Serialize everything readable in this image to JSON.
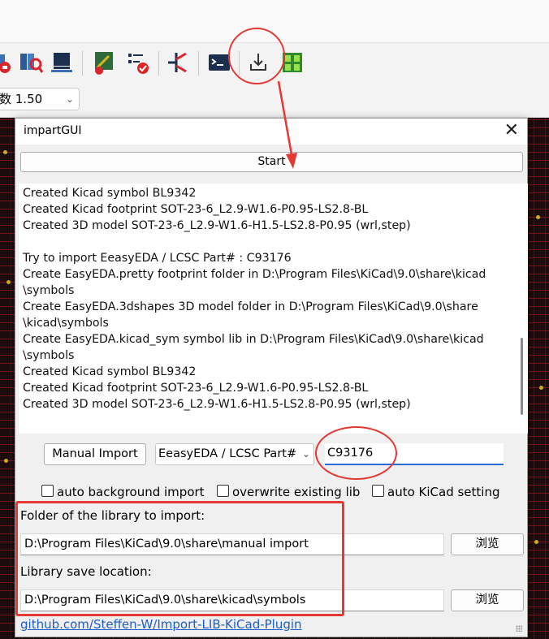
{
  "toolbar": {
    "zoom_value": "数 1.50",
    "icons": [
      "symbol-library-icon",
      "footprint-library-icon",
      "inspect-icon",
      "bom-icon",
      "netlist-update-icon",
      "erc-checklist-icon",
      "transistor-icon",
      "terminal-icon",
      "import-plugin-icon",
      "pcb-editor-icon"
    ]
  },
  "dialog": {
    "title": "impartGUI",
    "close_glyph": "✕",
    "start_label": "Start",
    "log_lines": [
      "Created Kicad symbol BL9342",
      "Created Kicad footprint SOT-23-6_L2.9-W1.6-P0.95-LS2.8-BL",
      "Created 3D model SOT-23-6_L2.9-W1.6-H1.5-LS2.8-P0.95 (wrl,step)",
      "",
      "Try to import EeasyEDA /  LCSC Part# : C93176",
      "Create EasyEDA.pretty footprint folder in D:\\Program Files\\KiCad\\9.0\\share\\kicad",
      "\\symbols",
      "Create EasyEDA.3dshapes 3D model folder in D:\\Program Files\\KiCad\\9.0\\share",
      "\\kicad\\symbols",
      "Create EasyEDA.kicad_sym symbol lib in D:\\Program Files\\KiCad\\9.0\\share\\kicad",
      "\\symbols",
      "Created Kicad symbol BL9342",
      "Created Kicad footprint SOT-23-6_L2.9-W1.6-P0.95-LS2.8-BL",
      "Created 3D model SOT-23-6_L2.9-W1.6-H1.5-LS2.8-P0.95 (wrl,step)"
    ],
    "manual_import_label": "Manual Import",
    "source_selected": "EeasyEDA /  LCSC Part#",
    "part_number": "C93176",
    "checkboxes": [
      {
        "label": "auto background import",
        "checked": false
      },
      {
        "label": "overwrite existing lib",
        "checked": false
      },
      {
        "label": "auto KiCad setting",
        "checked": false
      }
    ],
    "folder_label": "Folder of the library to import:",
    "folder_value": "D:\\Program Files\\KiCad\\9.0\\share\\manual import",
    "browse_label": "浏览",
    "save_label": "Library save location:",
    "save_value": "D:\\Program Files\\KiCad\\9.0\\share\\kicad\\symbols",
    "github_link": "github.com/Steffen-W/Import-LIB-KiCad-Plugin"
  },
  "annotation_color": "#e53935"
}
